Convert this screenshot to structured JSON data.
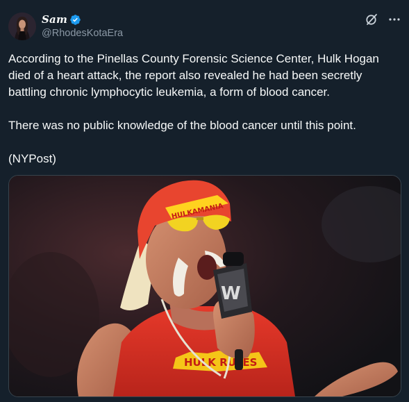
{
  "post": {
    "author": {
      "display_name": "Sam",
      "handle": "@RhodesKotaEra",
      "verified": true,
      "avatar": "avatar-photo"
    },
    "actions": {
      "grok_icon": "grok-icon",
      "more_icon": "more-horizontal-icon"
    },
    "text": {
      "paragraph_1": "According to the Pinellas County Forensic Science Center, Hulk Hogan died of a heart attack, the report also revealed he had been secretly battling chronic lymphocytic leukemia, a form of blood cancer.",
      "paragraph_2": "There was no public knowledge of the blood cancer until this point.",
      "paragraph_3": "(NYPost)"
    },
    "media": {
      "headband_text": "HULKAMANIA",
      "shirt_text": "HULK RULES"
    }
  },
  "colors": {
    "background": "#15202b",
    "text_primary": "#f7f9f9",
    "text_secondary": "#8b98a5",
    "verified_blue": "#1d9bf0",
    "border": "#38444d"
  }
}
